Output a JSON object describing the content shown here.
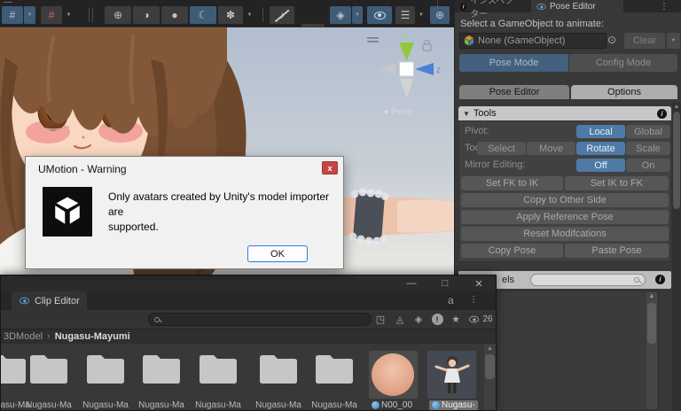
{
  "glyphs": {
    "minus": "—",
    "maximize": "□",
    "close_x": "✕",
    "arrow_down": "▼",
    "dots_menu": "⋮",
    "picker": "⊙",
    "breadcrumb_sep": "›",
    "star": "★",
    "scroll_up": "▲",
    "collapse_arrow": "▼",
    "info": "i",
    "exclaim": "!",
    "expand_pane": "◳",
    "filter_type": "◬",
    "tag": "◈"
  },
  "toolbar": {
    "grid_snap_icon": "#",
    "grid_move_icon": "#",
    "shade_wire_icon": "⊕",
    "shade_half_icon": "◑",
    "shade_lit_icon": "●",
    "moon_icon": "☾",
    "fx_flower_icon": "✽",
    "audio_off_icon": "♪",
    "post_off_icon": "ƒ",
    "overlays_icon": "◈",
    "layers_icon": "☰",
    "camera_icon": "▣",
    "gizmos_icon": "⊕"
  },
  "scene": {
    "axis_y": "y",
    "axis_z": "z",
    "persp_label": "◄ Persp"
  },
  "dialog": {
    "title": "UMotion - Warning",
    "close": "x",
    "message_line1": "Only avatars created by Unity's model importer are",
    "message_line2": "supported.",
    "ok": "OK"
  },
  "right_panel": {
    "tab_inspector": "インスペクター",
    "tab_pose_editor": "Pose Editor",
    "select_label": "Select a GameObject to animate:",
    "object_field": "None (GameObject)",
    "clear": "Clear",
    "pose_mode": "Pose Mode",
    "config_mode": "Config Mode",
    "subtab_pose_editor": "Pose Editor",
    "subtab_options": "Options",
    "tools": {
      "header": "Tools",
      "pivot_label": "Pivot:",
      "local": "Local",
      "global": "Global",
      "tool_label": "Tool:",
      "select": "Select",
      "move": "Move",
      "rotate": "Rotate",
      "scale": "Scale",
      "mirror_label": "Mirror Editing:",
      "off": "Off",
      "on": "On",
      "set_fk_to_ik": "Set FK to IK",
      "set_ik_to_fk": "Set IK to FK",
      "copy_to_other_side": "Copy to Other Side",
      "apply_reference_pose": "Apply Reference Pose",
      "reset_modifications": "Reset Modifcations",
      "copy_pose": "Copy Pose",
      "paste_pose": "Paste Pose"
    },
    "channels_header_partial": "els"
  },
  "clip_editor": {
    "title": "Clip Editor",
    "lock": "a",
    "breadcrumb_root": "3DModel",
    "breadcrumb_current": "Nugasu-Mayumi",
    "eye_count": "26",
    "folder_label": "Nugasu-Ma",
    "material_label": "N00_00",
    "model_label": "Nugasu-"
  },
  "colors": {
    "selection_blue": "#4f7aa6",
    "pose_mode_blue": "#44607f",
    "unity_panel": "#383838"
  }
}
